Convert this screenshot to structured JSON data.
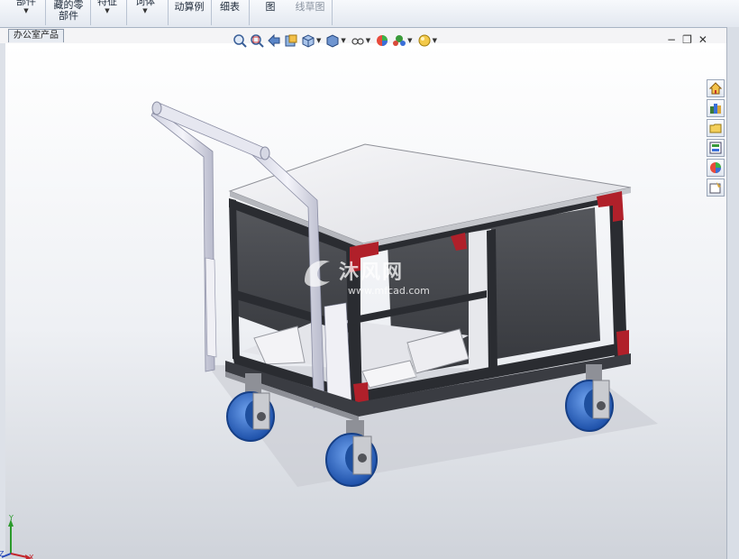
{
  "ribbon": {
    "items": [
      {
        "label_top": "部件",
        "label_bottom": ""
      },
      {
        "label_top": "藏的零",
        "label_bottom": "部件"
      },
      {
        "label_top": "特征",
        "label_bottom": ""
      },
      {
        "label_top": "词体",
        "label_bottom": ""
      },
      {
        "label_top": "动算例",
        "label_bottom": ""
      },
      {
        "label_top": "细表",
        "label_bottom": ""
      },
      {
        "label_top": "图",
        "label_bottom": ""
      },
      {
        "label_top": "线草图",
        "label_bottom": ""
      }
    ]
  },
  "document_tab": {
    "label": "办公室产品"
  },
  "watermark": {
    "brand": "沐风网",
    "url": "www.mfcad.com"
  },
  "triad": {
    "x": "X",
    "y": "Y",
    "z": "Z"
  },
  "icons": {
    "hud": [
      "zoom-to-fit-icon",
      "zoom-to-area-icon",
      "previous-view-icon",
      "section-view-icon",
      "view-orientation-icon",
      "display-style-icon",
      "hide-show-items-icon",
      "edit-appearance-icon",
      "apply-scene-icon",
      "view-settings-icon"
    ],
    "task_pane": [
      "home-icon",
      "design-library-icon",
      "file-explorer-icon",
      "view-palette-icon",
      "appearances-icon",
      "custom-properties-icon"
    ],
    "window": [
      "minimize-icon",
      "restore-icon",
      "close-icon"
    ]
  },
  "colors": {
    "accent_red": "#b0202a",
    "frame": "#2a2c31",
    "wheel": "#2d68c4",
    "panel": "#3e4046"
  }
}
